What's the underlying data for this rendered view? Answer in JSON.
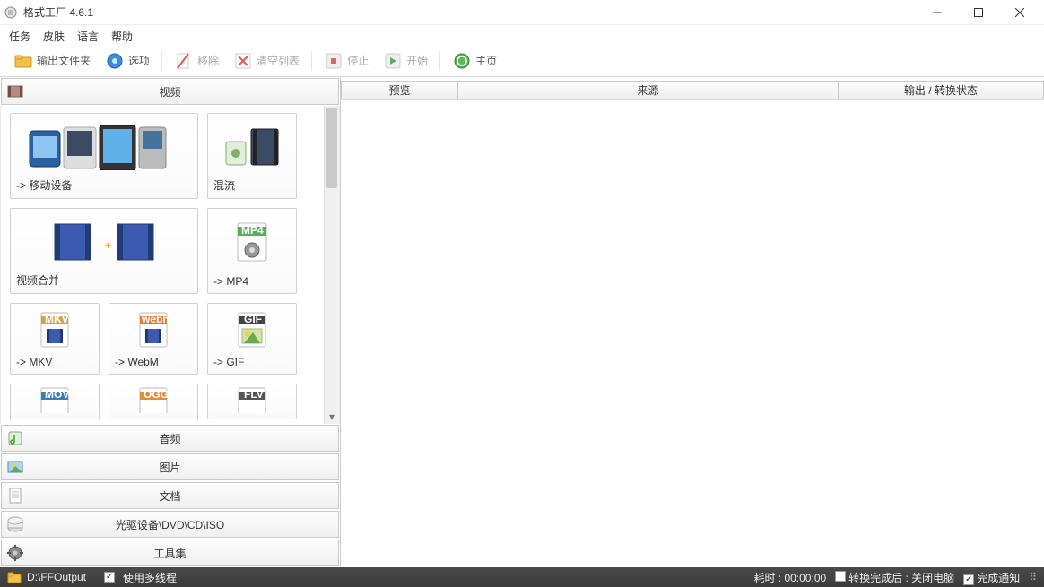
{
  "titlebar": {
    "title": "格式工厂 4.6.1"
  },
  "menu": {
    "task": "任务",
    "skin": "皮肤",
    "language": "语言",
    "help": "帮助"
  },
  "toolbar": {
    "output_folder": "输出文件夹",
    "options": "选项",
    "remove": "移除",
    "clear_list": "清空列表",
    "stop": "停止",
    "start": "开始",
    "home": "主页"
  },
  "accordion": {
    "video": "视频",
    "audio": "音频",
    "picture": "图片",
    "document": "文档",
    "disc": "光驱设备\\DVD\\CD\\ISO",
    "tools": "工具集"
  },
  "video_cards": {
    "mobile": "-> 移动设备",
    "mux": "混流",
    "merge": "视频合并",
    "mp4": "-> MP4",
    "mkv": "-> MKV",
    "webm": "-> WebM",
    "gif": "-> GIF"
  },
  "right_cols": {
    "preview": "预览",
    "source": "来源",
    "output_status": "输出 / 转换状态"
  },
  "status": {
    "path": "D:\\FFOutput",
    "multithread": "使用多线程",
    "elapsed_label": "耗时 :",
    "elapsed_val": "00:00:00",
    "shutdown": "转换完成后 : 关闭电脑",
    "notify": "完成通知"
  }
}
